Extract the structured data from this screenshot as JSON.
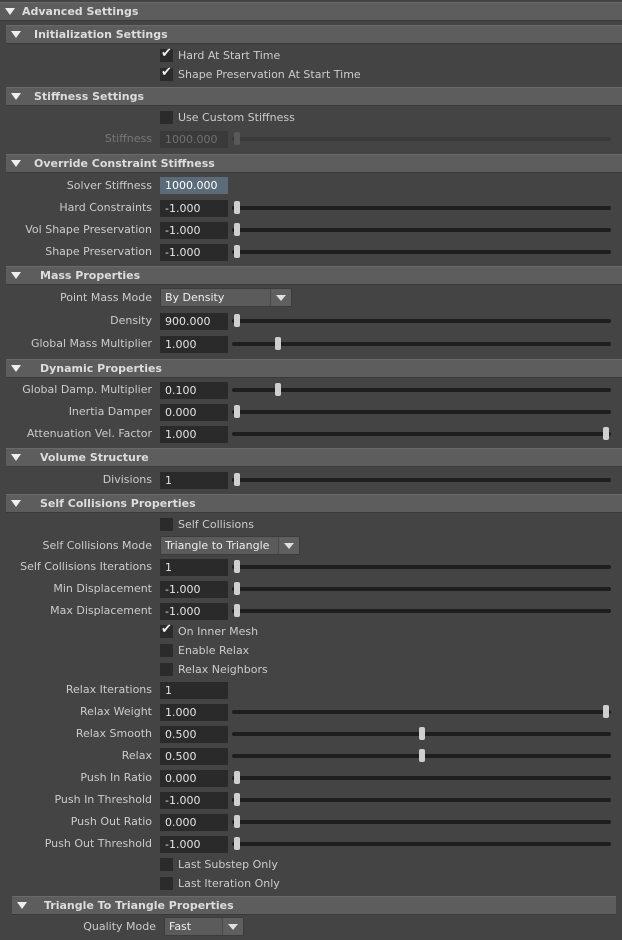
{
  "sections": {
    "advanced": "Advanced Settings",
    "init": "Initialization Settings",
    "stiffness": "Stiffness Settings",
    "override": "Override Constraint Stiffness",
    "mass": "Mass Properties",
    "dynamic": "Dynamic Properties",
    "volume": "Volume Structure",
    "self_col": "Self Collisions Properties",
    "tri": "Triangle To Triangle Properties"
  },
  "init": {
    "hard_at_start": {
      "label": "Hard At Start Time",
      "checked": true
    },
    "shape_pres_start": {
      "label": "Shape Preservation At Start Time",
      "checked": true
    }
  },
  "stiffness": {
    "use_custom": {
      "label": "Use Custom Stiffness",
      "checked": false
    },
    "stiffness": {
      "label": "Stiffness",
      "value": "1000.000",
      "slider": 0.0
    }
  },
  "override": {
    "solver": {
      "label": "Solver Stiffness",
      "value": "1000.000"
    },
    "hard": {
      "label": "Hard Constraints",
      "value": "-1.000",
      "slider": 0.0
    },
    "vol_shape": {
      "label": "Vol Shape Preservation",
      "value": "-1.000",
      "slider": 0.0
    },
    "shape": {
      "label": "Shape Preservation",
      "value": "-1.000",
      "slider": 0.0
    }
  },
  "mass": {
    "point_mode": {
      "label": "Point Mass Mode",
      "value": "By Density"
    },
    "density": {
      "label": "Density",
      "value": "900.000",
      "slider": 0.0
    },
    "global_mult": {
      "label": "Global Mass Multiplier",
      "value": "1.000",
      "slider": 0.11
    }
  },
  "dynamic": {
    "damp": {
      "label": "Global Damp. Multiplier",
      "value": "0.100",
      "slider": 0.11
    },
    "inertia": {
      "label": "Inertia Damper",
      "value": "0.000",
      "slider": 0.0
    },
    "atten": {
      "label": "Attenuation Vel. Factor",
      "value": "1.000",
      "slider": 1.0
    }
  },
  "volume": {
    "divisions": {
      "label": "Divisions",
      "value": "1",
      "slider": 0.0
    }
  },
  "self_col": {
    "enable": {
      "label": "Self Collisions",
      "checked": false
    },
    "mode": {
      "label": "Self Collisions Mode",
      "value": "Triangle to Triangle"
    },
    "iterations": {
      "label": "Self Collisions Iterations",
      "value": "1",
      "slider": 0.0
    },
    "min_disp": {
      "label": "Min Displacement",
      "value": "-1.000",
      "slider": 0.0
    },
    "max_disp": {
      "label": "Max Displacement",
      "value": "-1.000",
      "slider": 0.0
    },
    "inner_mesh": {
      "label": "On Inner Mesh",
      "checked": true
    },
    "enable_relax": {
      "label": "Enable Relax",
      "checked": false
    },
    "relax_neighbors": {
      "label": "Relax Neighbors",
      "checked": false
    },
    "relax_iter": {
      "label": "Relax Iterations",
      "value": "1"
    },
    "relax_weight": {
      "label": "Relax Weight",
      "value": "1.000",
      "slider": 1.0
    },
    "relax_smooth": {
      "label": "Relax Smooth",
      "value": "0.500",
      "slider": 0.5
    },
    "relax": {
      "label": "Relax",
      "value": "0.500",
      "slider": 0.5
    },
    "push_in_ratio": {
      "label": "Push In Ratio",
      "value": "0.000",
      "slider": 0.0
    },
    "push_in_thr": {
      "label": "Push In Threshold",
      "value": "-1.000",
      "slider": 0.0
    },
    "push_out_ratio": {
      "label": "Push Out Ratio",
      "value": "0.000",
      "slider": 0.0
    },
    "push_out_thr": {
      "label": "Push Out Threshold",
      "value": "-1.000",
      "slider": 0.0
    },
    "last_substep": {
      "label": "Last Substep Only",
      "checked": false
    },
    "last_iter": {
      "label": "Last Iteration Only",
      "checked": false
    }
  },
  "tri": {
    "quality": {
      "label": "Quality Mode",
      "value": "Fast"
    }
  },
  "check_glyph": "✔"
}
